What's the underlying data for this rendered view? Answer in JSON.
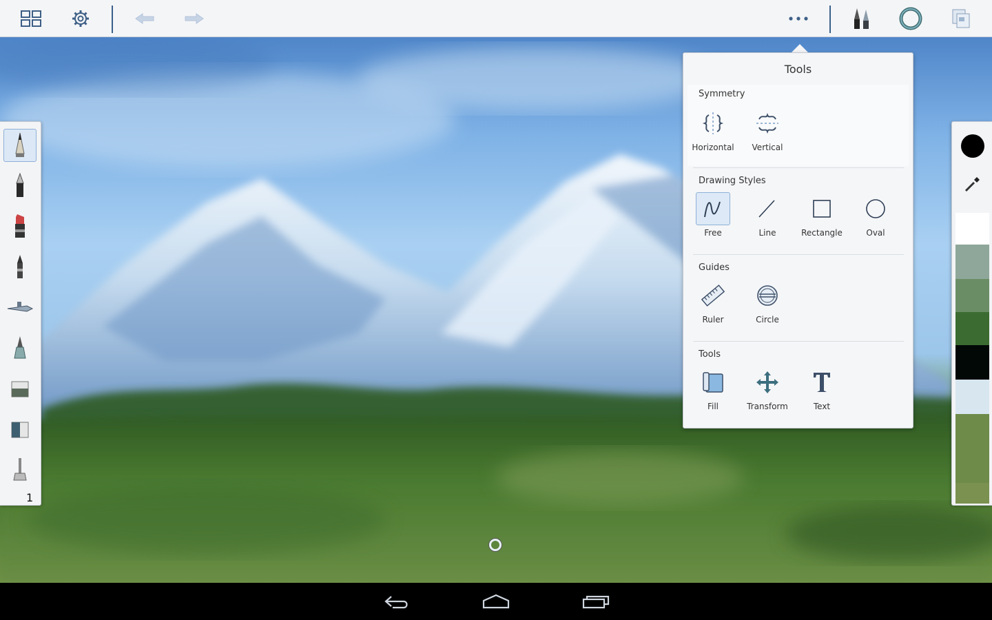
{
  "topbar": {
    "icons": {
      "gallery": "grid-icon",
      "settings": "gear-icon",
      "undo": "undo-arrow-icon",
      "redo": "redo-arrow-icon",
      "more": "more-dots-icon",
      "brushes": "brush-pair-icon",
      "brush_size": "ring-icon",
      "layers": "layers-icon"
    }
  },
  "tools_popup": {
    "title": "Tools",
    "sections": [
      {
        "heading": "Symmetry",
        "items": [
          {
            "label": "Horizontal",
            "icon": "symmetry-horizontal-icon"
          },
          {
            "label": "Vertical",
            "icon": "symmetry-vertical-icon"
          }
        ]
      },
      {
        "heading": "Drawing Styles",
        "items": [
          {
            "label": "Free",
            "icon": "freehand-icon",
            "selected": true
          },
          {
            "label": "Line",
            "icon": "line-icon"
          },
          {
            "label": "Rectangle",
            "icon": "rectangle-icon"
          },
          {
            "label": "Oval",
            "icon": "oval-icon"
          }
        ]
      },
      {
        "heading": "Guides",
        "items": [
          {
            "label": "Ruler",
            "icon": "ruler-icon"
          },
          {
            "label": "Circle",
            "icon": "circle-guide-icon"
          }
        ]
      },
      {
        "heading": "Tools",
        "items": [
          {
            "label": "Fill",
            "icon": "fill-bucket-icon"
          },
          {
            "label": "Transform",
            "icon": "transform-move-icon"
          },
          {
            "label": "Text",
            "icon": "text-T-icon"
          }
        ]
      }
    ]
  },
  "left_toolbar": {
    "brushes": [
      "pencil-icon",
      "ballpoint-pen-icon",
      "marker-icon",
      "felt-pen-icon",
      "airbrush-icon",
      "paintbrush-icon",
      "hard-eraser-icon",
      "soft-eraser-icon",
      "smudge-icon"
    ],
    "selected_index": 0,
    "layer_number": "1"
  },
  "right_colorbar": {
    "current_color": "#000000",
    "eyedropper_icon": "eyedropper-icon",
    "swatches": [
      "#ffffff",
      "#8ea79a",
      "#6b8d65",
      "#3c6b31",
      "#020805",
      "#d8e6f0",
      "#6e8b4a",
      "#7a9150"
    ]
  },
  "canvas": {
    "cursor_icon": "brush-cursor-icon"
  },
  "navbar": {
    "back": "back-icon",
    "home": "home-icon",
    "recents": "recent-apps-icon"
  },
  "colors": {
    "accent": "#3a72b0",
    "toolbar_bg": "#f4f5f7",
    "popup_bg": "#f5f6f8"
  }
}
